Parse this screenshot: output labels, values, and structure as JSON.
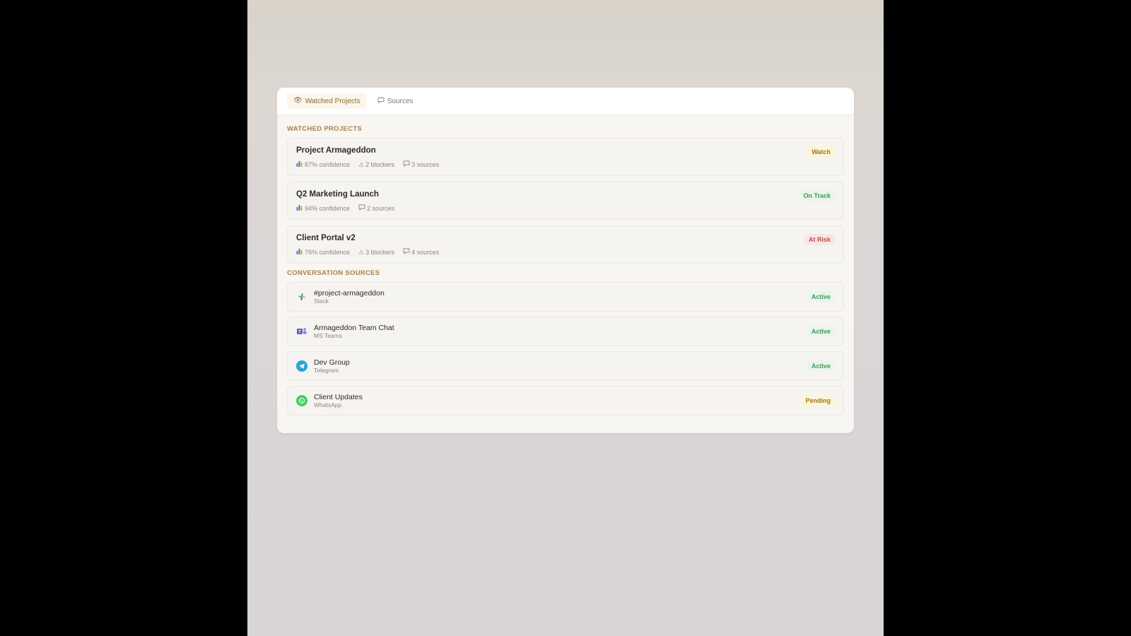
{
  "tabs": [
    {
      "label": "Watched Projects",
      "icon": "eye-icon",
      "active": true
    },
    {
      "label": "Sources",
      "icon": "chat-bubble-icon",
      "active": false
    }
  ],
  "watched": {
    "section_title": "WATCHED PROJECTS",
    "projects": [
      {
        "name": "Project Armageddon",
        "confidence": "87% confidence",
        "blockers": "2 blockers",
        "sources": "3 sources",
        "status": "Watch"
      },
      {
        "name": "Q2 Marketing Launch",
        "confidence": "94% confidence",
        "blockers": "",
        "sources": "2 sources",
        "status": "On Track"
      },
      {
        "name": "Client Portal v2",
        "confidence": "76% confidence",
        "blockers": "3 blockers",
        "sources": "4 sources",
        "status": "At Risk"
      }
    ]
  },
  "sources": {
    "section_title": "CONVERSATION SOURCES",
    "items": [
      {
        "name": "#project-armageddon",
        "platform": "Slack",
        "status": "Active",
        "icon": "slack-icon"
      },
      {
        "name": "Armageddon Team Chat",
        "platform": "MS Teams",
        "status": "Active",
        "icon": "ms-teams-icon"
      },
      {
        "name": "Dev Group",
        "platform": "Telegram",
        "status": "Active",
        "icon": "telegram-icon"
      },
      {
        "name": "Client Updates",
        "platform": "WhatsApp",
        "status": "Pending",
        "icon": "whatsapp-icon"
      }
    ]
  },
  "colors": {
    "accent": "#a9814a",
    "active_green": "#3c9957",
    "risk_red": "#c44848",
    "watch_yellow": "#9a7a22"
  }
}
